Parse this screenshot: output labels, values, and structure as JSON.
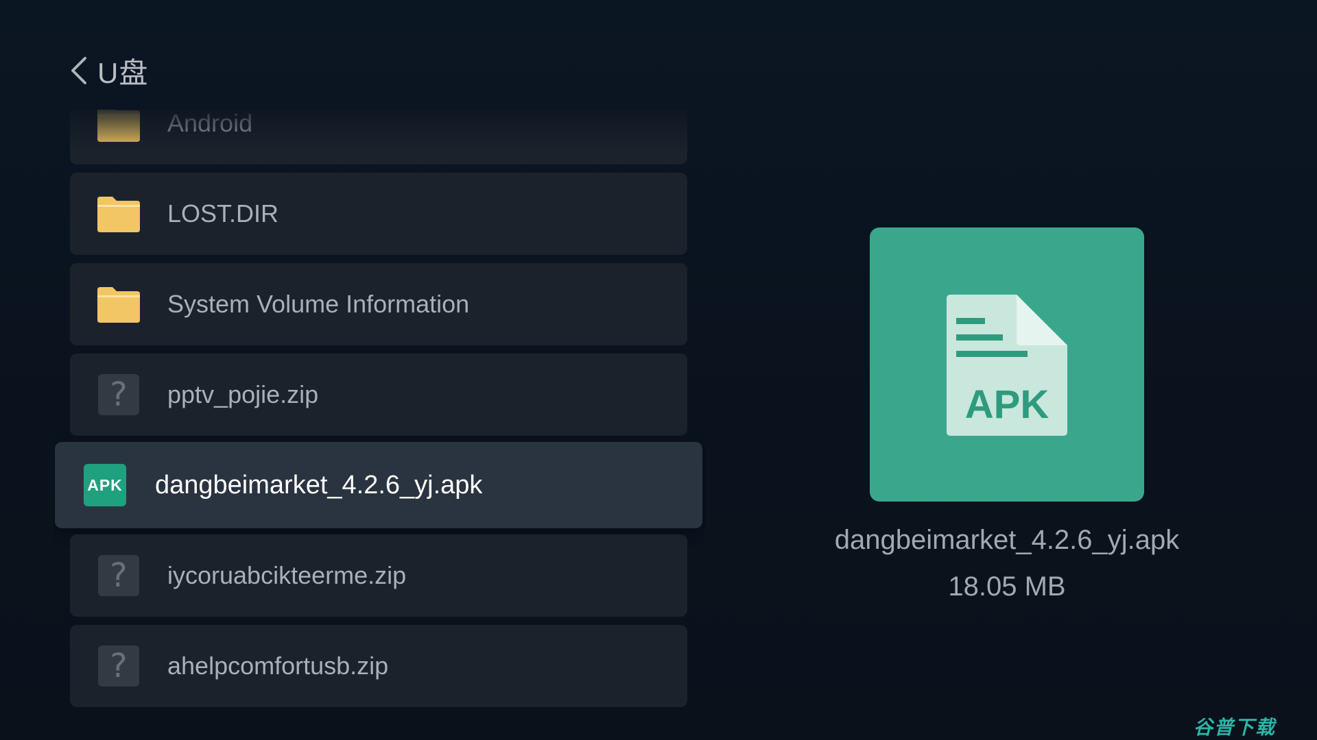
{
  "header": {
    "title": "U盘"
  },
  "files": [
    {
      "name": "Android",
      "type": "folder"
    },
    {
      "name": "LOST.DIR",
      "type": "folder"
    },
    {
      "name": "System Volume Information",
      "type": "folder"
    },
    {
      "name": "pptv_pojie.zip",
      "type": "unknown"
    },
    {
      "name": "dangbeimarket_4.2.6_yj.apk",
      "type": "apk",
      "selected": true
    },
    {
      "name": "iycoruabcikteerme.zip",
      "type": "unknown"
    },
    {
      "name": "ahelpcomfortusb.zip",
      "type": "unknown"
    }
  ],
  "icons": {
    "apk_badge": "APK",
    "unknown_glyph": "?",
    "preview_label": "APK"
  },
  "preview": {
    "file_name": "dangbeimarket_4.2.6_yj.apk",
    "file_size": "18.05 MB"
  },
  "watermark": "谷普下载",
  "colors": {
    "accent_green": "#3aa78c",
    "folder_yellow": "#f2c565",
    "selected_row": "#2a3440",
    "row": "#1b222c"
  }
}
